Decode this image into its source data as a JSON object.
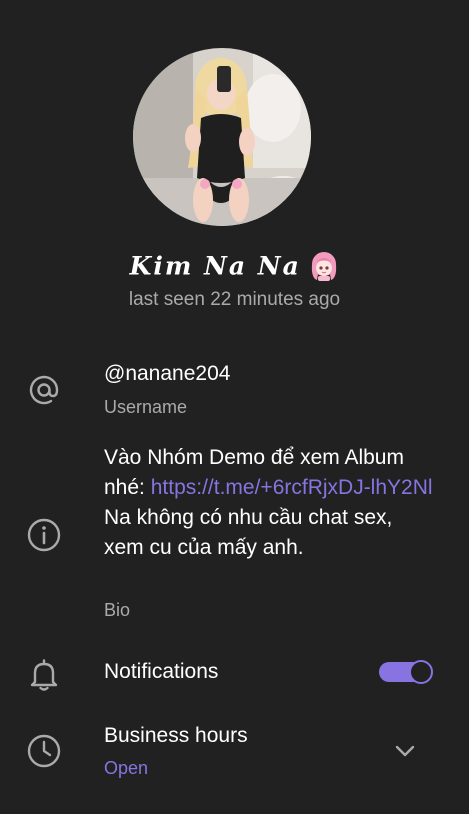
{
  "profile": {
    "name": "𝑲𝒊𝒎 𝑵𝒂 𝑵𝒂",
    "last_seen": "last seen 22 minutes ago"
  },
  "username": {
    "value": "@nanane204",
    "label": "Username",
    "icon": "at-icon"
  },
  "bio": {
    "text_before": "Vào Nhóm Demo để xem Album nhé: ",
    "link": "https://t.me/+6rcfRjxDJ-lhY2Nl",
    "text_after": " Na không có nhu cầu chat sex, xem cu của mấy anh.",
    "label": "Bio",
    "icon": "info-icon"
  },
  "notifications": {
    "label": "Notifications",
    "enabled": true,
    "icon": "bell-icon"
  },
  "business_hours": {
    "label": "Business hours",
    "status": "Open",
    "icon": "clock-icon"
  },
  "colors": {
    "background": "#212121",
    "accent": "#8774e1",
    "secondary_text": "#aaaaaa",
    "icon": "#aaaaaa"
  }
}
